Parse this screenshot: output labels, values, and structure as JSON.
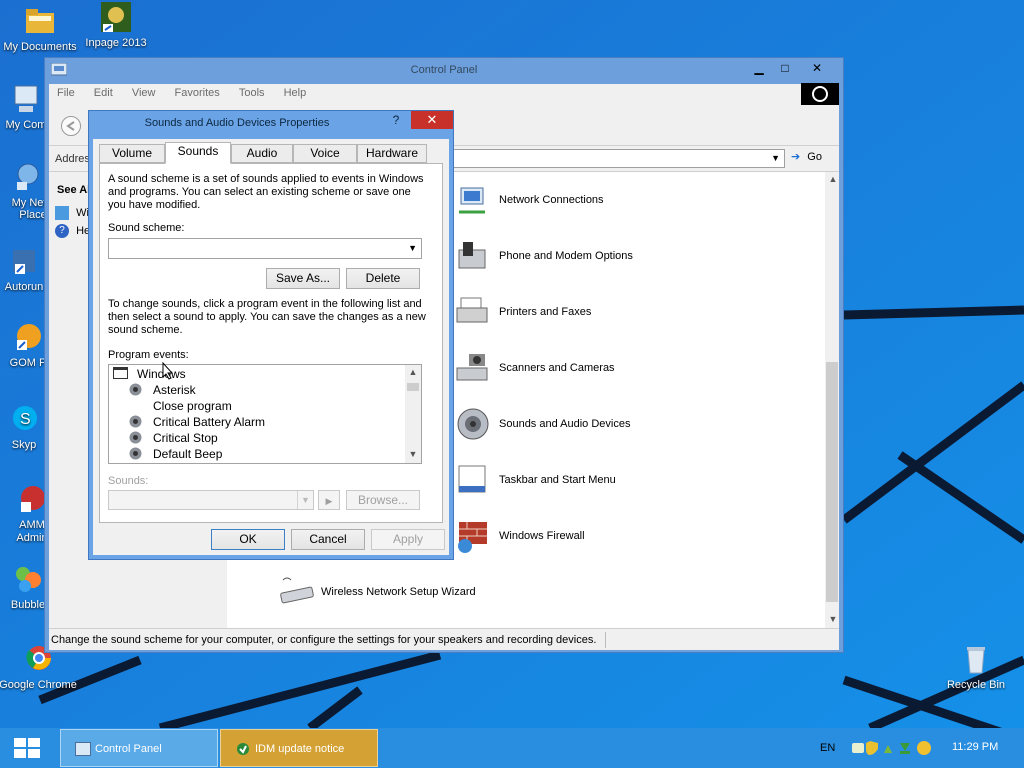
{
  "desktop": {
    "icons": [
      {
        "label": "My Documents",
        "icon": "folder-icon"
      },
      {
        "label": "Inpage 2013",
        "icon": "inpage-icon"
      },
      {
        "label": "My Com",
        "icon": "computer-icon"
      },
      {
        "label": "My Netw Place",
        "icon": "network-places-icon"
      },
      {
        "label": "Autorun",
        "icon": "autorun-icon"
      },
      {
        "label": "GOM P",
        "icon": "gom-player-icon"
      },
      {
        "label": "Skyp",
        "icon": "skype-icon"
      },
      {
        "label": "AMM Admin",
        "icon": "amm-icon"
      },
      {
        "label": "Bubble",
        "icon": "bubble-icon"
      },
      {
        "label": "Google Chrome",
        "icon": "chrome-icon"
      },
      {
        "label": "Recycle Bin",
        "icon": "recycle-bin-icon"
      }
    ]
  },
  "control_panel": {
    "title": "Control Panel",
    "menu": [
      "File",
      "Edit",
      "View",
      "Favorites",
      "Tools",
      "Help"
    ],
    "address_label": "Addres",
    "go_label": "Go",
    "see_also": "See Al",
    "left_items": [
      "Wi",
      "He"
    ],
    "items": [
      {
        "label": "Network Connections",
        "icon": "network-connections-icon"
      },
      {
        "label": "Phone and Modem Options",
        "icon": "phone-modem-icon"
      },
      {
        "label": "Printers and Faxes",
        "icon": "printer-icon"
      },
      {
        "label": "Scanners and Cameras",
        "icon": "scanner-camera-icon"
      },
      {
        "label": "Sounds and Audio Devices",
        "icon": "speaker-icon"
      },
      {
        "label": "Taskbar and Start Menu",
        "icon": "taskbar-icon"
      },
      {
        "label": "Windows Firewall",
        "icon": "firewall-icon"
      },
      {
        "label": "Wireless Network Setup Wizard",
        "icon": "wireless-icon"
      }
    ],
    "status_text": "Change the sound scheme for your computer, or configure the settings for your speakers and recording devices."
  },
  "dialog": {
    "title": "Sounds and Audio Devices Properties",
    "help_label": "?",
    "close_label": "✕",
    "tabs": [
      "Volume",
      "Sounds",
      "Audio",
      "Voice",
      "Hardware"
    ],
    "active_tab": "Sounds",
    "intro_text": "A sound scheme is a set of sounds applied to events in Windows and programs. You can select an existing scheme or save one you have modified.",
    "scheme_label": "Sound scheme:",
    "scheme_value": "",
    "save_as_label": "Save As...",
    "delete_label": "Delete",
    "change_text": "To change sounds, click a program event in the following list and then select a sound to apply. You can save the changes as a new sound scheme.",
    "events_label": "Program events:",
    "events": [
      {
        "label": "Windows",
        "has_sound": false,
        "is_group": true
      },
      {
        "label": "Asterisk",
        "has_sound": true,
        "is_group": false
      },
      {
        "label": "Close program",
        "has_sound": false,
        "is_group": false
      },
      {
        "label": "Critical Battery Alarm",
        "has_sound": true,
        "is_group": false
      },
      {
        "label": "Critical Stop",
        "has_sound": true,
        "is_group": false
      },
      {
        "label": "Default Beep",
        "has_sound": true,
        "is_group": false
      }
    ],
    "sounds_label": "Sounds:",
    "browse_label": "Browse...",
    "ok_label": "OK",
    "cancel_label": "Cancel",
    "apply_label": "Apply"
  },
  "taskbar": {
    "tasks": [
      {
        "label": "Control Panel",
        "icon": "control-panel-icon"
      },
      {
        "label": "IDM update notice",
        "icon": "idm-icon"
      }
    ],
    "language": "EN",
    "time": "11:29 PM"
  },
  "colors": {
    "accent": "#2a8ee0",
    "dialog_frame": "#6aa3e6",
    "close_red": "#c7312a"
  }
}
